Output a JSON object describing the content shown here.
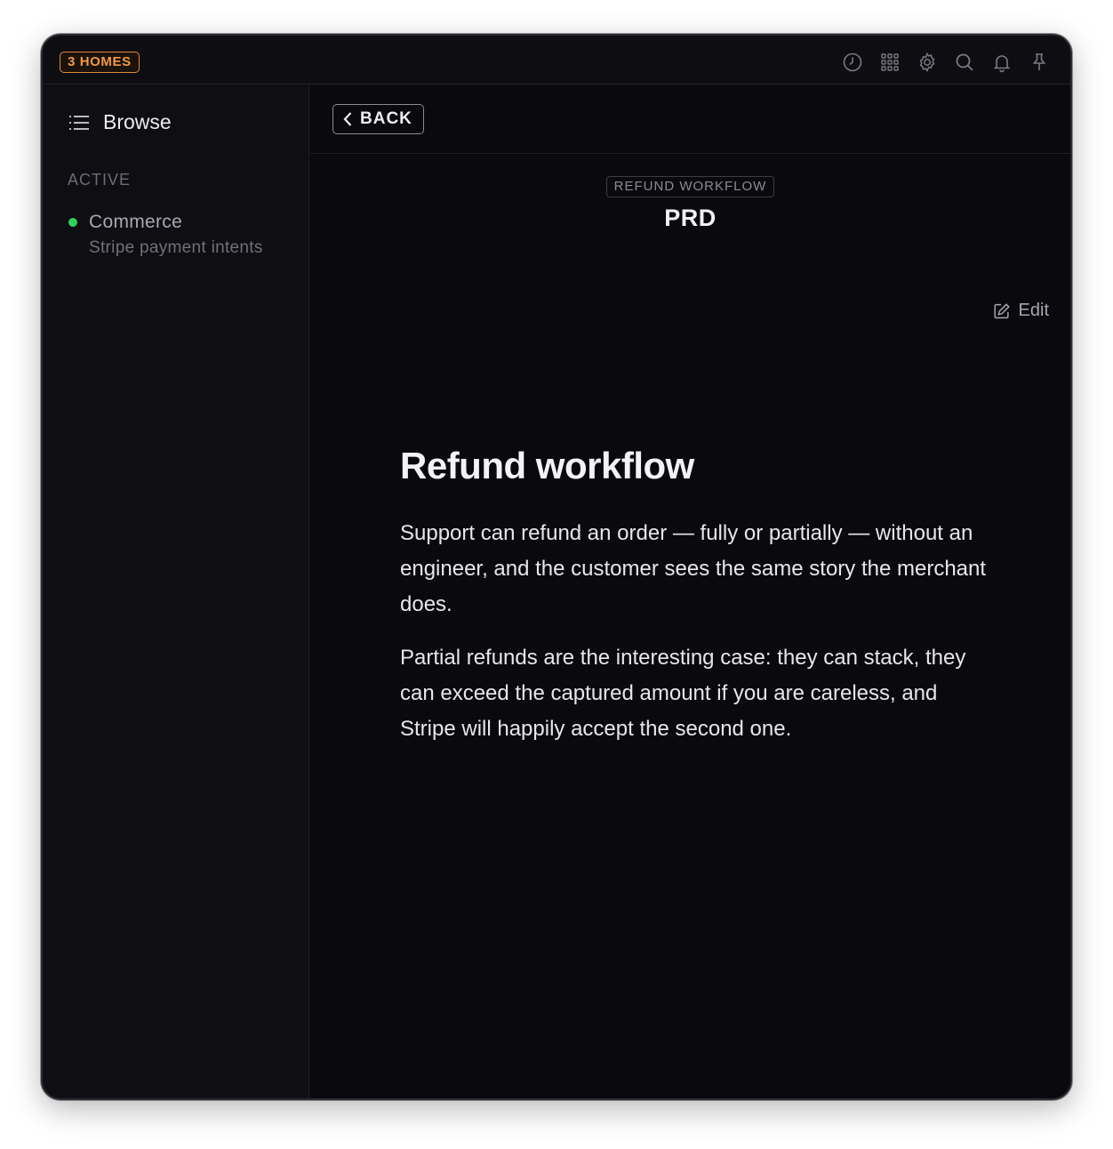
{
  "topbar": {
    "homes_label": "3 HOMES",
    "icons": [
      "history-icon",
      "apps-grid-icon",
      "gear-icon",
      "search-icon",
      "bell-icon",
      "pin-icon"
    ]
  },
  "sidebar": {
    "browse_label": "Browse",
    "section_label": "ACTIVE",
    "projects": [
      {
        "name": "Commerce",
        "description": "Stripe payment intents",
        "status_color": "#2fd15a"
      }
    ]
  },
  "main": {
    "back_label": "BACK",
    "doc_kind": "REFUND WORKFLOW",
    "doc_type": "PRD",
    "edit_label": "Edit",
    "title": "Refund workflow",
    "paragraphs": [
      "Support can refund an order — fully or partially — without an engineer, and the customer sees the same story the merchant does.",
      "Partial refunds are the interesting case: they can stack, they can exceed the captured amount if you are careless, and Stripe will happily accept the second one."
    ]
  },
  "colors": {
    "accent": "#f09a45",
    "background": "#0a0a0e",
    "status_active": "#2fd15a"
  }
}
